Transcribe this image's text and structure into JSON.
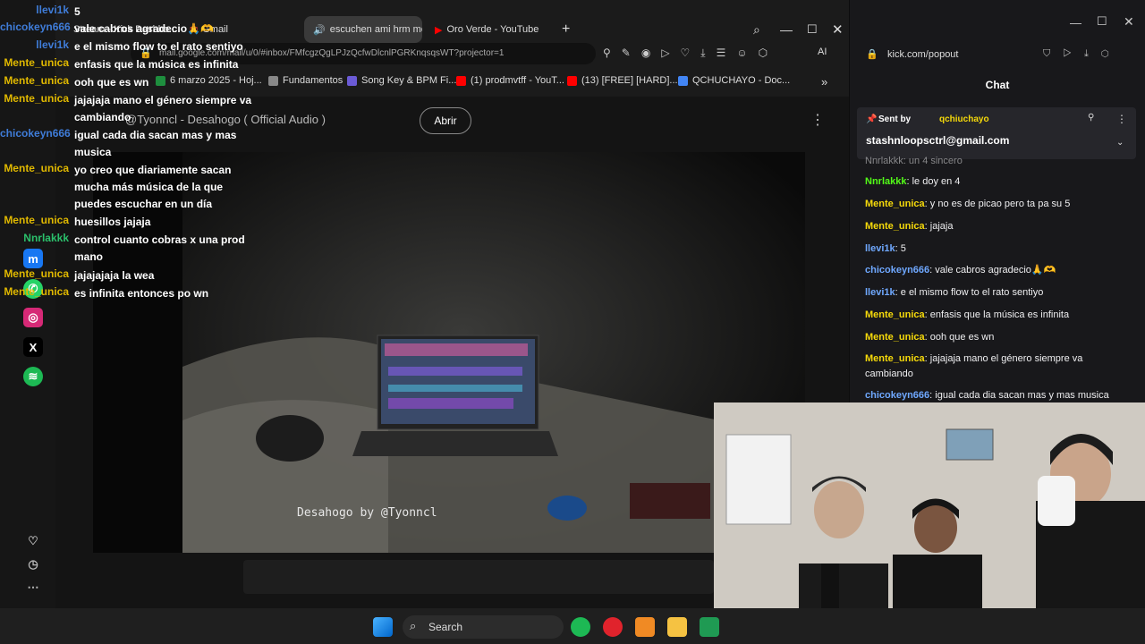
{
  "browser": {
    "tabs": [
      {
        "label": "Stream - Kick Dashbo..."
      },
      {
        "label": "Gmail"
      },
      {
        "label": "escuchen ami hrm me"
      },
      {
        "label": "Oro Verde - YouTube"
      }
    ],
    "url": "mail.google.com/mail/u/0/#inbox/FMfcgzQgLPJzQcfwDlcnlPGRKnqsqsWT?projector=1",
    "ai_label": "AI",
    "bookmarks": [
      {
        "label": "6 marzo 2025 - Hoj...",
        "color": "#1e8e3e"
      },
      {
        "label": "Fundamentos",
        "color": "#888888"
      },
      {
        "label": "Song Key & BPM Fi...",
        "color": "#6b5bd6"
      },
      {
        "label": "(1) prodmvtff - YouT...",
        "color": "#ff0000"
      },
      {
        "label": "(13) [FREE] [HARD]...",
        "color": "#ff0000"
      },
      {
        "label": "QCHUCHAYO - Doc...",
        "color": "#4285f4"
      }
    ]
  },
  "youtube": {
    "title": "@Tyonncl - Desahogo ( Official Audio )",
    "open_button": "Abrir",
    "watermark": "Desahogo by @Tyonncl"
  },
  "overlay_chat": [
    {
      "user": "llevi1k",
      "text": "5",
      "color": "#3f7cd8"
    },
    {
      "user": "chicokeyn666",
      "text": "vale cabros agradecio🙏🫶",
      "color": "#3f7cd8"
    },
    {
      "user": "llevi1k",
      "text": "e el mismo flow to el rato sentiyo",
      "color": "#3f7cd8"
    },
    {
      "user": "Mente_unica",
      "text": "enfasis que la música es infinita",
      "color": "#e0b800"
    },
    {
      "user": "Mente_unica",
      "text": "ooh que es wn",
      "color": "#e0b800"
    },
    {
      "user": "Mente_unica",
      "text": "jajajaja mano el género siempre va cambiando",
      "color": "#e0b800"
    },
    {
      "user": "chicokeyn666",
      "text": "igual cada dia sacan mas y mas musica",
      "color": "#3f7cd8"
    },
    {
      "user": "Mente_unica",
      "text": "yo creo que diariamente sacan mucha más música de la que puedes escuchar en un día",
      "color": "#e0b800"
    },
    {
      "user": "Mente_unica",
      "text": "huesillos jajaja",
      "color": "#e0b800"
    },
    {
      "user": "Nnrlakkk",
      "text": "control cuanto cobras x una prod mano",
      "color": "#2bbf6b"
    },
    {
      "user": "Mente_unica",
      "text": "jajajajaja la wea",
      "color": "#e0b800"
    },
    {
      "user": "Mente_unica",
      "text": "es infinita entonces po wn",
      "color": "#e0b800"
    }
  ],
  "popout": {
    "url": "kick.com/popout",
    "header": "Chat",
    "pinned_sent_by": "Sent by",
    "pinned_user": "qchiuchayo",
    "pinned_text": "stashnloopsctrl@gmail.com",
    "partial_top": "Nnrlakkk: un 4 sincero",
    "messages": [
      {
        "user": "Nnrlakkk",
        "text": "le doy en 4",
        "color": "#53fc18"
      },
      {
        "user": "Mente_unica",
        "text": "y no es de picao pero ta pa su 5",
        "color": "#f5d90a"
      },
      {
        "user": "Mente_unica",
        "text": "jajaja",
        "color": "#f5d90a"
      },
      {
        "user": "llevi1k",
        "text": "5",
        "color": "#6fa8ff"
      },
      {
        "user": "chicokeyn666",
        "text": "vale cabros agradecio🙏🫶",
        "color": "#6fa8ff"
      },
      {
        "user": "llevi1k",
        "text": "e el mismo flow to el rato sentiyo",
        "color": "#6fa8ff"
      },
      {
        "user": "Mente_unica",
        "text": "enfasis que la música es infinita",
        "color": "#f5d90a"
      },
      {
        "user": "Mente_unica",
        "text": "ooh que es wn",
        "color": "#f5d90a"
      },
      {
        "user": "Mente_unica",
        "text": "jajajaja mano el género siempre va cambiando",
        "color": "#f5d90a"
      },
      {
        "user": "chicokeyn666",
        "text": "igual cada dia sacan mas y mas musica",
        "color": "#6fa8ff"
      }
    ]
  },
  "taskbar": {
    "search_label": "Search"
  }
}
